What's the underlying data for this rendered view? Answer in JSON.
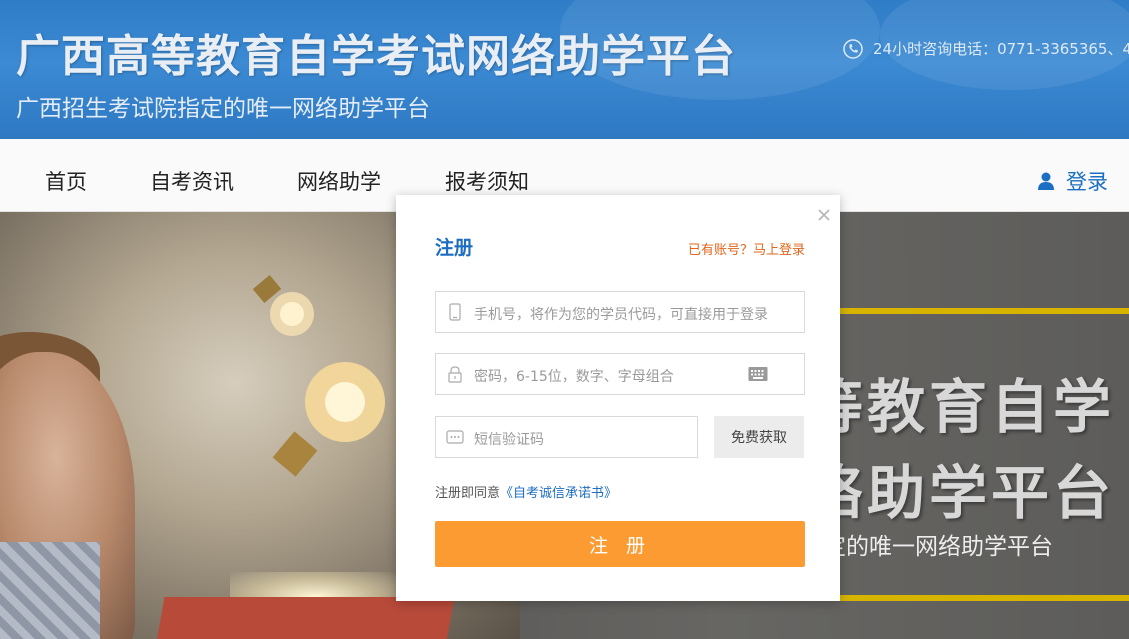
{
  "header": {
    "title": "广西高等教育自学考试网络助学平台",
    "subtitle": "广西招生考试院指定的唯一网络助学平台",
    "hotline": "24小时咨询电话：0771-3365365、4"
  },
  "nav": {
    "items": [
      {
        "label": "首页"
      },
      {
        "label": "自考资讯"
      },
      {
        "label": "网络助学"
      },
      {
        "label": "报考须知"
      }
    ],
    "login": "登录"
  },
  "banner": {
    "title_line1": "等教育自学",
    "title_line2": "络助学平台",
    "subtitle": "指定的唯一网络助学平台"
  },
  "modal": {
    "title": "注册",
    "have_account": "已有账号？马上登录",
    "phone_placeholder": "手机号，将作为您的学员代码，可直接用于登录",
    "password_placeholder": "密码，6-15位，数字、字母组合",
    "sms_placeholder": "短信验证码",
    "sms_button": "免费获取",
    "agree_prefix": "注册即同意",
    "agree_link": "《自考诚信承诺书》",
    "submit": "注 册"
  },
  "colors": {
    "brand_blue": "#2f7cc7",
    "title_blue": "#1d6dc0",
    "accent_orange": "#fb9b32",
    "link_orange": "#e0661c"
  }
}
